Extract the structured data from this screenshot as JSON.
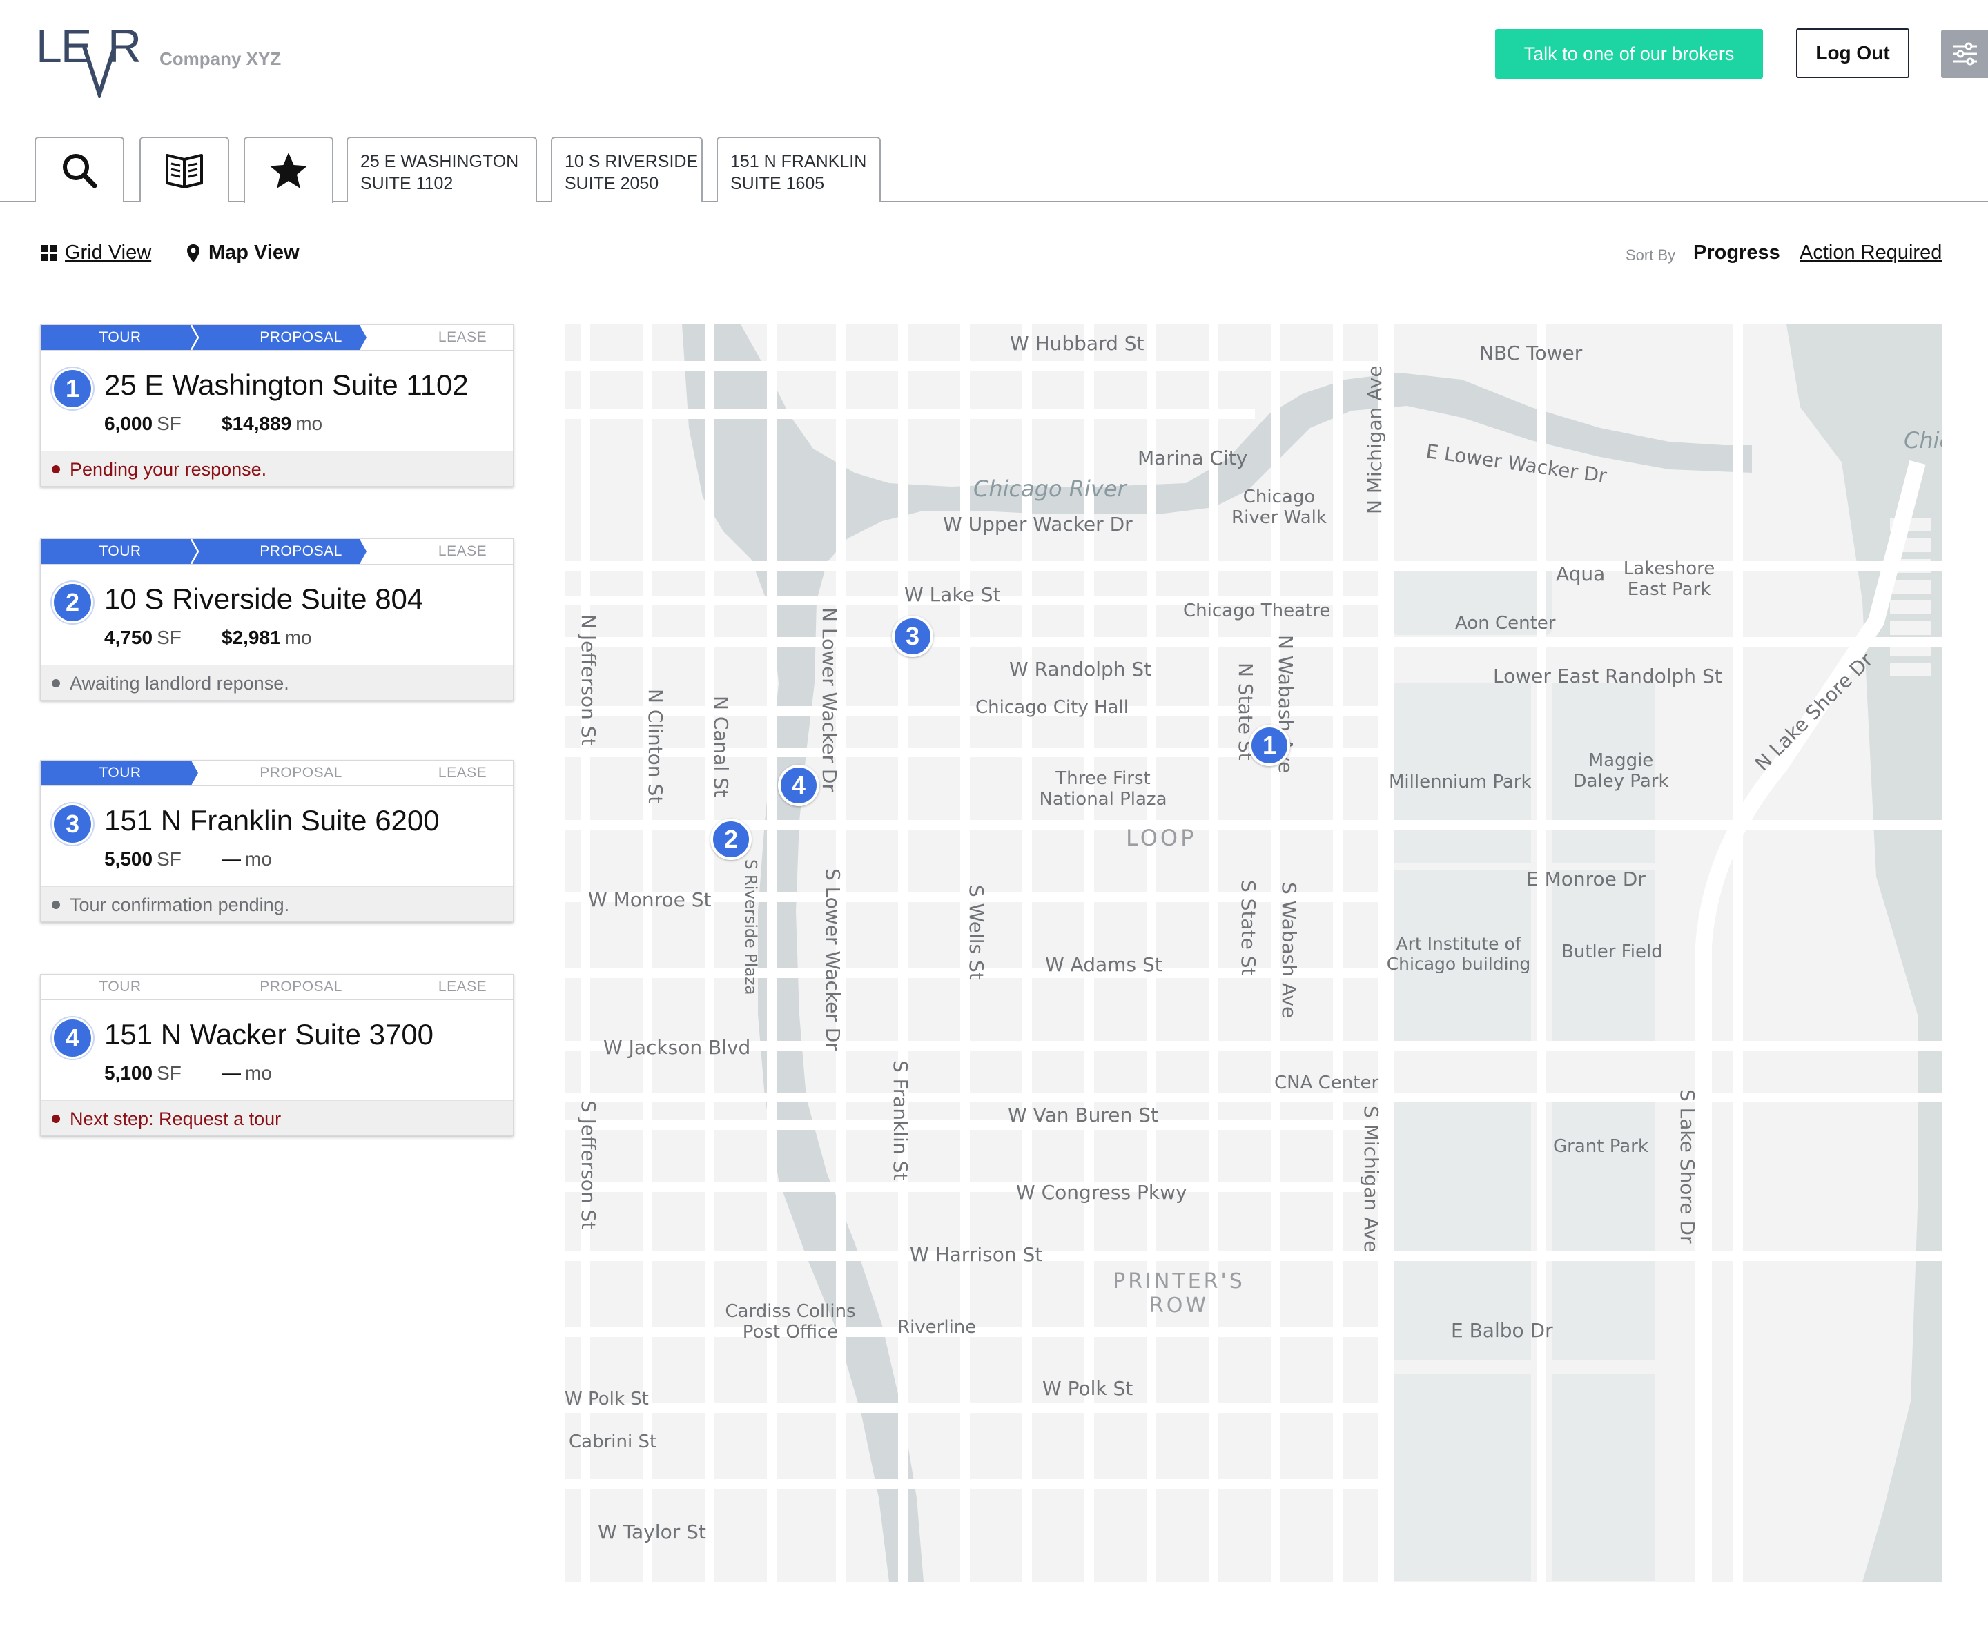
{
  "header": {
    "logo_text": "LEVR",
    "company": "Company XYZ",
    "broker_button": "Talk to one of our brokers",
    "logout_button": "Log Out",
    "settings_icon": "sliders-icon"
  },
  "tabs": {
    "icons": [
      "search-icon",
      "book-icon",
      "star-icon"
    ],
    "active_icon": "star-icon",
    "properties": [
      {
        "line1": "25 E WASHINGTON",
        "line2": "SUITE 1102"
      },
      {
        "line1": "10 S RIVERSIDE",
        "line2": "SUITE 2050"
      },
      {
        "line1": "151 N FRANKLIN",
        "line2": "SUITE 1605"
      }
    ]
  },
  "view": {
    "grid_label": "Grid View",
    "map_label": "Map View",
    "sort_by": "Sort By",
    "sort_progress": "Progress",
    "sort_action": "Action Required"
  },
  "stages": [
    "TOUR",
    "PROPOSAL",
    "LEASE"
  ],
  "colors": {
    "accent_blue": "#3b6fe0",
    "broker_green": "#1dd4a3",
    "alert_red": "#8b0f14",
    "neutral_gray": "#6b6e72"
  },
  "properties": [
    {
      "num": "1",
      "title": "25 E Washington Suite 1102",
      "sf": "6,000",
      "sf_unit": "SF",
      "rent": "$14,889",
      "rent_unit": "mo",
      "stages_completed": 2,
      "status": "Pending your response.",
      "status_color": "#8b0f14"
    },
    {
      "num": "2",
      "title": "10 S Riverside Suite 804",
      "sf": "4,750",
      "sf_unit": "SF",
      "rent": "$2,981",
      "rent_unit": "mo",
      "stages_completed": 2,
      "status": "Awaiting landlord reponse.",
      "status_color": "#6b6e72"
    },
    {
      "num": "3",
      "title": "151 N Franklin Suite 6200",
      "sf": "5,500",
      "sf_unit": "SF",
      "rent": "—",
      "rent_unit": "mo",
      "stages_completed": 1,
      "status": "Tour confirmation pending.",
      "status_color": "#6b6e72"
    },
    {
      "num": "4",
      "title": "151 N Wacker Suite 3700",
      "sf": "5,100",
      "sf_unit": "SF",
      "rent": "—",
      "rent_unit": "mo",
      "stages_completed": 0,
      "status": "Next step: Request a tour",
      "status_color": "#8b0f14"
    }
  ],
  "map": {
    "pins": [
      "1",
      "2",
      "3",
      "4"
    ],
    "labels": {
      "w_hubbard": "W Hubbard St",
      "nbc_tower": "NBC Tower",
      "chic": "Chic",
      "n_michigan_top": "N Michigan Ave",
      "marina_city": "Marina City",
      "e_lower_wacker": "E Lower Wacker Dr",
      "chicago_river": "Chicago River",
      "chicago_river_walk": "Chicago\nRiver Walk",
      "w_upper_wacker": "W Upper Wacker Dr",
      "aqua": "Aqua",
      "lakeshore_east_park": "Lakeshore\nEast Park",
      "w_lake": "W Lake St",
      "chicago_theatre": "Chicago Theatre",
      "aon_center": "Aon Center",
      "n_lake_shore": "N Lake Shore Dr",
      "n_jefferson": "N Jefferson St",
      "n_lower_wacker": "N Lower Wacker Dr",
      "w_randolph": "W Randolph St",
      "n_state": "N State St",
      "n_wabash": "N Wabash Ave",
      "lower_east_randolph": "Lower East Randolph St",
      "chicago_city_hall": "Chicago City Hall",
      "n_clinton": "N Clinton St",
      "n_canal": "N Canal St",
      "three_first": "Three First\nNational Plaza",
      "millennium_park": "Millennium Park",
      "maggie_daley": "Maggie\nDaley Park",
      "loop": "LOOP",
      "s_riverside": "S Riverside Plaza",
      "s_lower_wacker": "S Lower Wacker Dr",
      "s_wells": "S Wells St",
      "s_state": "S State St",
      "s_wabash": "S Wabash Ave",
      "w_monroe": "W Monroe St",
      "e_monroe": "E Monroe Dr",
      "w_adams": "W Adams St",
      "art_institute": "Art Institute of\nChicago building",
      "butler_field": "Butler Field",
      "w_jackson": "W Jackson Blvd",
      "s_franklin": "S Franklin St",
      "cna_center": "CNA Center",
      "s_jefferson": "S Jefferson St",
      "w_van_buren": "W Van Buren St",
      "s_michigan": "S Michigan Ave",
      "grant_park": "Grant Park",
      "s_lake_shore": "S Lake Shore Dr",
      "w_congress": "W Congress Pkwy",
      "w_harrison": "W Harrison St",
      "printers_row": "PRINTER'S\nROW",
      "cardiss_collins": "Cardiss Collins\nPost Office",
      "riverline": "Riverline",
      "e_balbo": "E Balbo Dr",
      "w_polk_left": "W Polk St",
      "w_polk": "W Polk St",
      "cabrini": "Cabrini St",
      "w_taylor": "W Taylor St"
    }
  }
}
